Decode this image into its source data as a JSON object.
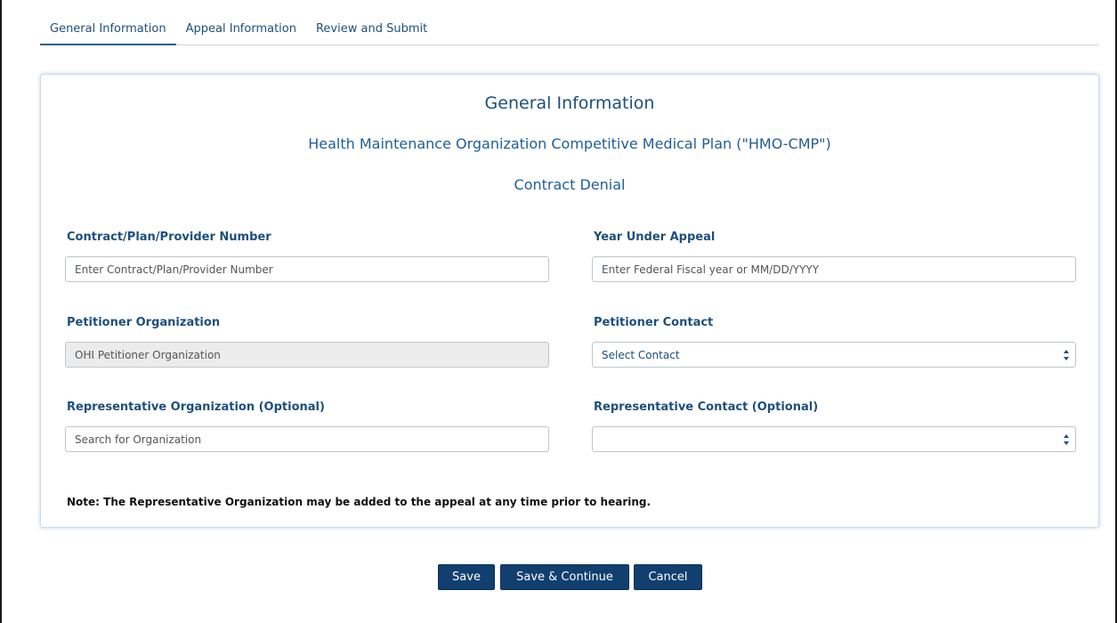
{
  "tabs": [
    {
      "label": "General Information",
      "active": true
    },
    {
      "label": "Appeal Information",
      "active": false
    },
    {
      "label": "Review and Submit",
      "active": false
    }
  ],
  "panel": {
    "title": "General Information",
    "subtitle": "Health Maintenance Organization Competitive Medical Plan (\"HMO-CMP\")",
    "subtitle2": "Contract Denial"
  },
  "fields": {
    "contract_number": {
      "label": "Contract/Plan/Provider Number",
      "value": "",
      "placeholder": "Enter Contract/Plan/Provider Number"
    },
    "year_under_appeal": {
      "label": "Year Under Appeal",
      "value": "",
      "placeholder": "Enter Federal Fiscal year or MM/DD/YYYY"
    },
    "petitioner_organization": {
      "label": "Petitioner Organization",
      "value": "OHI Petitioner Organization"
    },
    "petitioner_contact": {
      "label": "Petitioner Contact",
      "selected": "Select Contact"
    },
    "representative_organization": {
      "label": "Representative Organization (Optional)",
      "value": "",
      "placeholder": "Search for Organization"
    },
    "representative_contact": {
      "label": "Representative Contact (Optional)",
      "selected": ""
    }
  },
  "note": "Note: The Representative Organization may be added to the appeal at any time prior to hearing.",
  "buttons": {
    "save": "Save",
    "save_continue": "Save & Continue",
    "cancel": "Cancel"
  },
  "colors": {
    "accent": "#1d4f7c",
    "button": "#113f6f",
    "panel_border": "#c9dcef"
  }
}
